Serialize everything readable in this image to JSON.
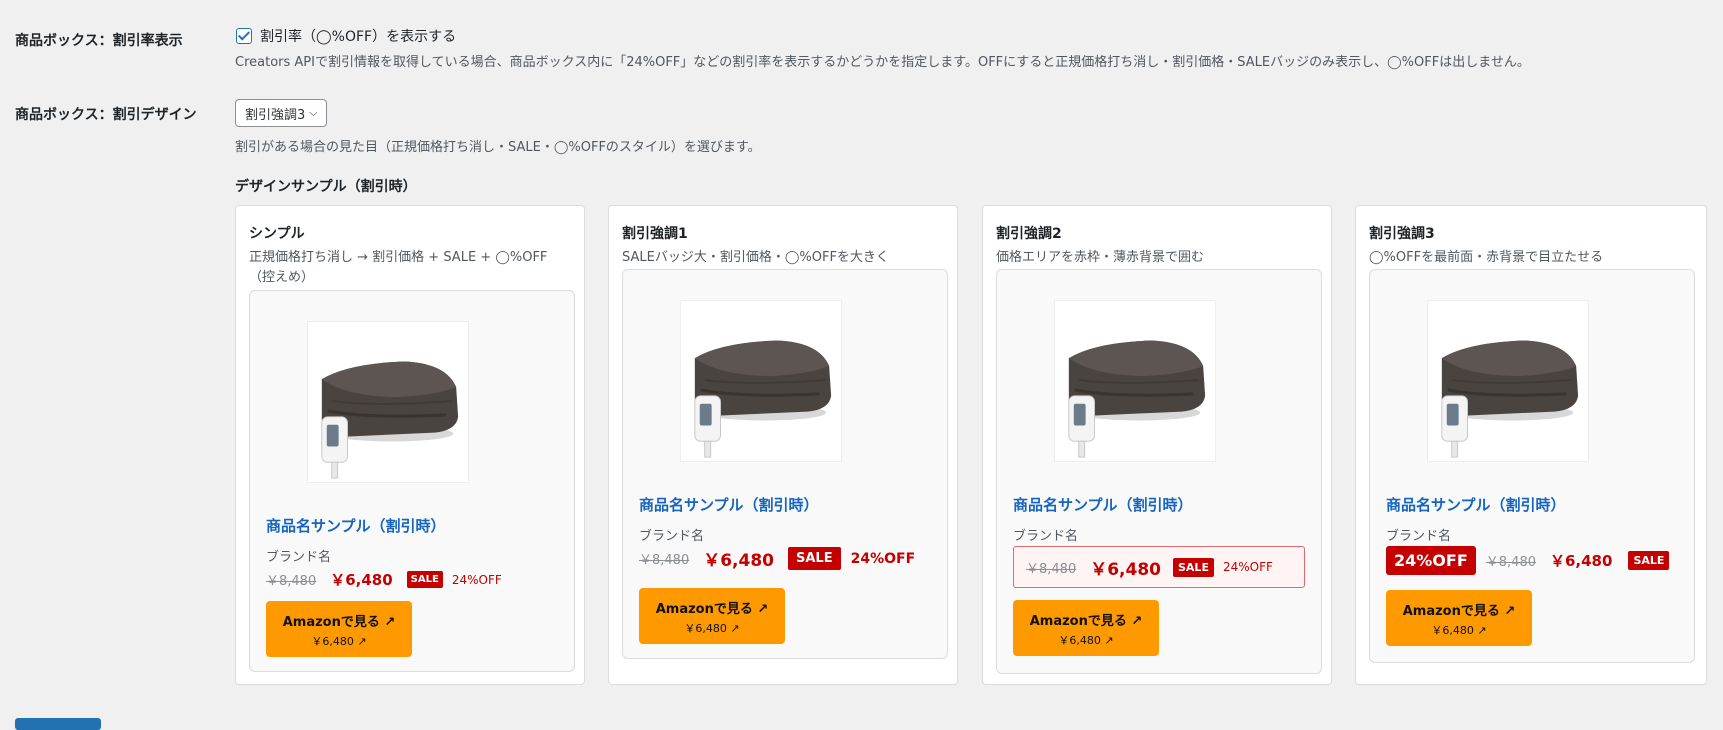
{
  "settings": {
    "rate_label": "商品ボックス：割引率表示",
    "rate_checkbox_label": "割引率（◯%OFF）を表示する",
    "rate_desc": "Creators APIで割引情報を取得している場合、商品ボックス内に「24%OFF」などの割引率を表示するかどうかを指定します。OFFにすると正規価格打ち消し・割引価格・SALEバッジのみ表示し、◯%OFFは出しません。",
    "design_label": "商品ボックス：割引デザイン",
    "design_select_value": "割引強調3",
    "design_desc": "割引がある場合の見た目（正規価格打ち消し・SALE・◯%OFFのスタイル）を選びます。",
    "sample_title": "デザインサンプル（割引時）"
  },
  "product": {
    "name": "商品名サンプル（割引時）",
    "brand": "ブランド名",
    "old_price": "￥8,480",
    "new_price": "￥6,480",
    "sale": "SALE",
    "off": "24%OFF",
    "button_line1": "Amazonで見る ↗",
    "button_line2": "￥6,480 ↗"
  },
  "samples": [
    {
      "title": "シンプル",
      "subtitle": "正規価格打ち消し → 割引価格 + SALE + ◯%OFF（控えめ）"
    },
    {
      "title": "割引強調1",
      "subtitle": "SALEバッジ大・割引価格・◯%OFFを大きく"
    },
    {
      "title": "割引強調2",
      "subtitle": "価格エリアを赤枠・薄赤背景で囲む"
    },
    {
      "title": "割引強調3",
      "subtitle": "◯%OFFを最前面・赤背景で目立たせる"
    }
  ],
  "colors": {
    "accent": "#2271b1",
    "price_red": "#c40000",
    "amazon_orange": "#ff9900",
    "name_blue": "#1565c0"
  },
  "icons": [
    "checkbox-checked-icon",
    "chevron-down-icon",
    "external-link-icon"
  ]
}
